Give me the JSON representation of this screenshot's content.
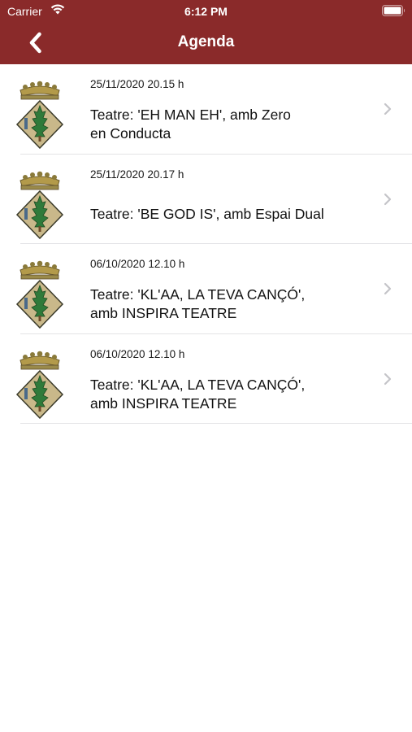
{
  "status_bar": {
    "carrier": "Carrier",
    "time": "6:12 PM"
  },
  "nav": {
    "title": "Agenda",
    "back_icon": "chevron-left-icon"
  },
  "colors": {
    "header": "#8a2a2a",
    "separator": "#e3e3e6",
    "chevron": "#c4c4c8"
  },
  "events": [
    {
      "date": "25/11/2020 20.15 h",
      "title_lines": [
        "Teatre: 'EH MAN EH', amb Zero",
        "en Conducta"
      ]
    },
    {
      "date": "25/11/2020 20.17 h",
      "title_lines": [
        "Teatre: 'BE GOD IS', amb Espai Dual"
      ]
    },
    {
      "date": "06/10/2020 12.10 h",
      "title_lines": [
        "Teatre: 'KL'AA, LA TEVA CANÇÓ',",
        "amb INSPIRA TEATRE"
      ]
    },
    {
      "date": "06/10/2020 12.10 h",
      "title_lines": [
        "Teatre: 'KL'AA, LA TEVA CANÇÓ',",
        "amb INSPIRA TEATRE"
      ]
    }
  ]
}
